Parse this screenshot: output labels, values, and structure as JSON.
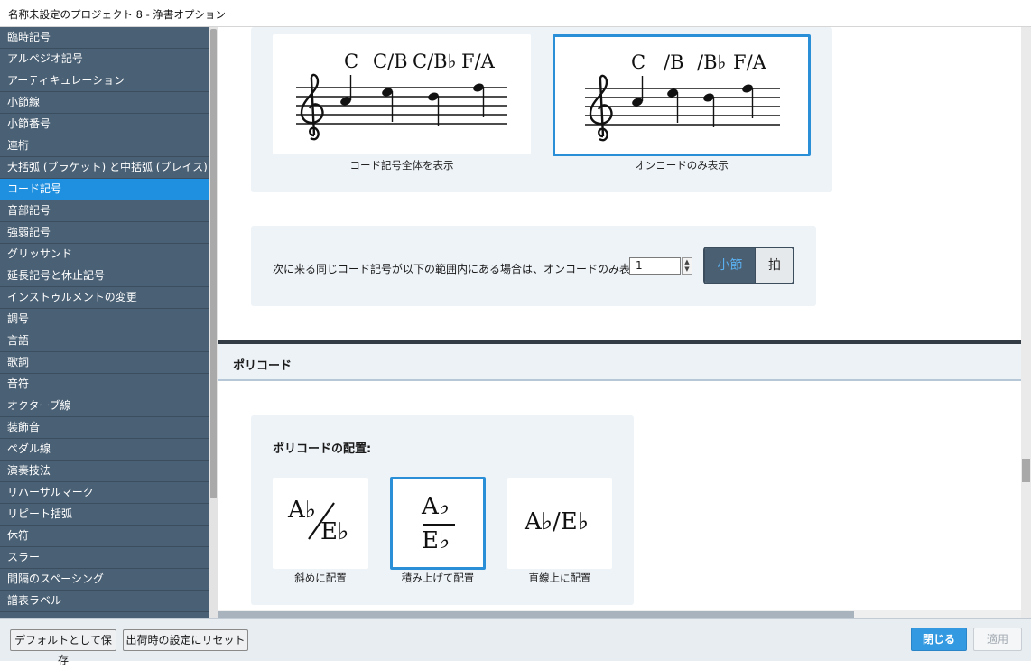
{
  "window": {
    "title": "名称未設定のプロジェクト 8 - 浄書オプション"
  },
  "sidebar": {
    "items": [
      "臨時記号",
      "アルペジオ記号",
      "アーティキュレーション",
      "小節線",
      "小節番号",
      "連桁",
      "大括弧 (ブラケット) と中括弧 (ブレイス)",
      "コード記号",
      "音部記号",
      "強弱記号",
      "グリッサンド",
      "延長記号と休止記号",
      "インストゥルメントの変更",
      "調号",
      "言語",
      "歌詞",
      "音符",
      "オクターブ線",
      "装飾音",
      "ペダル線",
      "演奏技法",
      "リハーサルマーク",
      "リピート括弧",
      "休符",
      "スラー",
      "間隔のスペーシング",
      "譜表ラベル"
    ],
    "active_index": 7
  },
  "chord_display": {
    "option_full": {
      "labels": [
        "C",
        "C/B",
        "C/B♭",
        "F/A"
      ],
      "caption": "コード記号全体を表示"
    },
    "option_slash_only": {
      "labels": [
        "C",
        "/B",
        "/B♭",
        "F/A"
      ],
      "caption": "オンコードのみ表示",
      "selected": true
    }
  },
  "range_setting": {
    "label": "次に来る同じコード記号が以下の範囲内にある場合は、オンコードのみ表示:",
    "value": "1",
    "toggle": {
      "bar": "小節",
      "beat": "拍",
      "selected": "bar"
    }
  },
  "polychord": {
    "section_title": "ポリコード",
    "group_label": "ポリコードの配置:",
    "options": [
      {
        "top": "A♭",
        "bottom": "E♭",
        "caption": "斜めに配置"
      },
      {
        "top": "A♭",
        "bottom": "E♭",
        "caption": "積み上げて配置",
        "selected": true
      },
      {
        "text": "A♭/E♭",
        "caption": "直線上に配置"
      }
    ]
  },
  "footer": {
    "save_default": "デフォルトとして保存",
    "reset_factory": "出荷時の設定にリセット",
    "close": "閉じる",
    "apply": "適用"
  },
  "colors": {
    "accent": "#2b8fd8",
    "sidebar": "#4a6074",
    "sidebar_active": "#1f90e0"
  }
}
